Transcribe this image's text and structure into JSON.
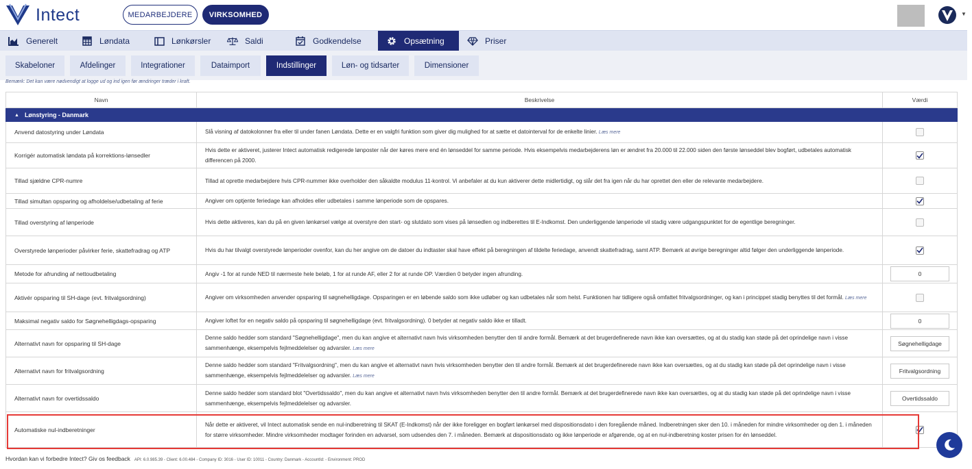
{
  "app": {
    "brand": "Intect",
    "mode_tabs": [
      {
        "label": "MEDARBEJDERE",
        "active": false
      },
      {
        "label": "VIRKSOMHED",
        "active": true
      }
    ]
  },
  "main_nav": [
    {
      "label": "Generelt",
      "icon": "bar-chart-icon",
      "active": false
    },
    {
      "label": "Løndata",
      "icon": "table-grid-icon",
      "active": false
    },
    {
      "label": "Lønkørsler",
      "icon": "window-icon",
      "active": false
    },
    {
      "label": "Saldi",
      "icon": "scale-icon",
      "active": false
    },
    {
      "label": "Godkendelse",
      "icon": "calendar-check-icon",
      "active": false
    },
    {
      "label": "Opsætning",
      "icon": "gear-icon",
      "active": true
    },
    {
      "label": "Priser",
      "icon": "diamond-icon",
      "active": false
    }
  ],
  "sub_nav": [
    {
      "label": "Skabeloner",
      "active": false
    },
    {
      "label": "Afdelinger",
      "active": false
    },
    {
      "label": "Integrationer",
      "active": false
    },
    {
      "label": "Dataimport",
      "active": false
    },
    {
      "label": "Indstillinger",
      "active": true
    },
    {
      "label": "Løn- og tidsarter",
      "active": false
    },
    {
      "label": "Dimensioner",
      "active": false
    }
  ],
  "note": "Bemærk: Det kan være nødvendigt at logge ud og ind igen før ændringer træder i kraft.",
  "table": {
    "headers": {
      "name": "Navn",
      "description": "Beskrivelse",
      "value": "Værdi"
    },
    "section": "Lønstyring - Danmark",
    "rows": [
      {
        "name": "Anvend datostyring under Løndata",
        "desc": "Slå visning af datokolonner fra eller til under fanen Løndata. Dette er en valgfri funktion som giver dig mulighed for at sætte et datointerval for de enkelte linier.",
        "more": "Læs mere",
        "type": "checkbox",
        "checked": false
      },
      {
        "name": "Korrigér automatisk løndata på korrektions-lønsedler",
        "desc": "Hvis dette er aktiveret, justerer Intect automatisk redigerede lønposter når der køres mere end én lønseddel for samme periode. Hvis eksempelvis medarbejderens løn er ændret fra 20.000 til 22.000 siden den første lønseddel blev bogført, udbetales automatisk differencen på 2000.",
        "more": "",
        "type": "checkbox",
        "checked": true
      },
      {
        "name": "Tillad sjældne CPR-numre",
        "desc": "Tillad at oprette medarbejdere hvis CPR-nummer ikke overholder den såkaldte modulus 11-kontrol. Vi anbefaler at du kun aktiverer dette midlertidigt, og slår det fra igen når du har oprettet den eller de relevante medarbejdere.",
        "more": "",
        "type": "checkbox",
        "checked": false
      },
      {
        "name": "Tillad simultan opsparing og afholdelse/udbetaling af ferie",
        "desc": "Angiver om optjente feriedage kan afholdes eller udbetales i samme lønperiode som de opspares.",
        "more": "",
        "type": "checkbox",
        "checked": true
      },
      {
        "name": "Tillad overstyring af lønperiode",
        "desc": "Hvis dette aktiveres, kan du på en given lønkørsel vælge at overstyre den start- og slutdato som vises på lønsedlen og indberettes til E-Indkomst. Den underliggende lønperiode vil stadig være udgangspunktet for de egentlige beregninger.",
        "more": "",
        "type": "checkbox",
        "checked": false
      },
      {
        "name": "Overstyrede lønperioder påvirker ferie, skattefradrag og ATP",
        "desc": "Hvis du har tilvalgt overstyrede lønperioder ovenfor, kan du her angive om de datoer du indtaster skal have effekt på beregningen af tildelte feriedage, anvendt skattefradrag, samt ATP. Bemærk at øvrige beregninger altid følger den underliggende lønperiode.",
        "more": "",
        "type": "checkbox",
        "checked": true
      },
      {
        "name": "Metode for afrunding af nettoudbetaling",
        "desc": "Angiv -1 for at runde NED til nærmeste hele beløb, 1 for at runde AF, eller 2 for at runde OP. Værdien 0 betyder ingen afrunding.",
        "more": "",
        "type": "input",
        "value": "0"
      },
      {
        "name": "Aktivér opsparing til SH-dage (evt. fritvalgsordning)",
        "desc": "Angiver om virksomheden anvender opsparing til søgnehelligdage. Opsparingen er en løbende saldo som ikke udløber og kan udbetales når som helst. Funktionen har tidligere også omfattet fritvalgsordninger, og kan i princippet stadig benyttes til det formål.",
        "more": "Læs mere",
        "type": "checkbox",
        "checked": false
      },
      {
        "name": "Maksimal negativ saldo for Søgnehelligdags-opsparing",
        "desc": "Angiver loftet for en negativ saldo på opsparing til søgnehelligdage (evt. fritvalgsordning). 0 betyder at negativ saldo ikke er tilladt.",
        "more": "",
        "type": "input",
        "value": "0"
      },
      {
        "name": "Alternativt navn for opsparing til SH-dage",
        "desc": "Denne saldo hedder som standard \"Søgnehelligdage\", men du kan angive et alternativt navn hvis virksomheden benytter den til andre formål. Bemærk at det brugerdefinerede navn ikke kan oversættes, og at du stadig kan støde på det oprindelige navn i visse sammenhænge, eksempelvis fejlmeddelelser og advarsler.",
        "more": "Læs mere",
        "type": "input",
        "value": "Søgnehelligdage"
      },
      {
        "name": "Alternativt navn for fritvalgsordning",
        "desc": "Denne saldo hedder som standard \"Fritvalgsordning\", men du kan angive et alternativt navn hvis virksomheden benytter den til andre formål. Bemærk at det brugerdefinerede navn ikke kan oversættes, og at du stadig kan støde på det oprindelige navn i visse sammenhænge, eksempelvis fejlmeddelelser og advarsler.",
        "more": "Læs mere",
        "type": "input",
        "value": "Fritvalgsordning"
      },
      {
        "name": "Alternativt navn for overtidssaldo",
        "desc": "Denne saldo hedder som standard blot \"Overtidssaldo\", men du kan angive et alternativt navn hvis virksomheden benytter den til andre formål. Bemærk at det brugerdefinerede navn ikke kan oversættes, og at du stadig kan støde på det oprindelige navn i visse sammenhænge, eksempelvis fejlmeddelelser og advarsler.",
        "more": "",
        "type": "input",
        "value": "Overtidssaldo"
      },
      {
        "name": "Automatiske nul-indberetninger",
        "desc": "Når dette er aktiveret, vil Intect automatisk sende en nul-indberetning til SKAT (E-Indkomst) når der ikke foreligger en bogført lønkørsel med dispositionsdato i den foregående måned. Indberetningen sker den 10. i måneden for mindre virksomheder og den 1. i måneden for større virksomheder. Mindre virksomheder modtager forinden en advarsel, som udsendes den 7. i måneden. Bemærk at dispositionsdato og ikke lønperiode er afgørende, og at en nul-indberetning koster prisen for én lønseddel.",
        "more": "",
        "type": "checkbox",
        "checked": true
      }
    ]
  },
  "footer": {
    "feedback_q": "Hvordan kan vi forbedre Intect?",
    "feedback_link": "Giv os feedback",
    "meta": "API: 6.0.985.39 - Client: 6.00.484 - Company ID: 3016 - User ID: 10011 - Country: Danmark - AccountId: - Environment: PROD"
  }
}
